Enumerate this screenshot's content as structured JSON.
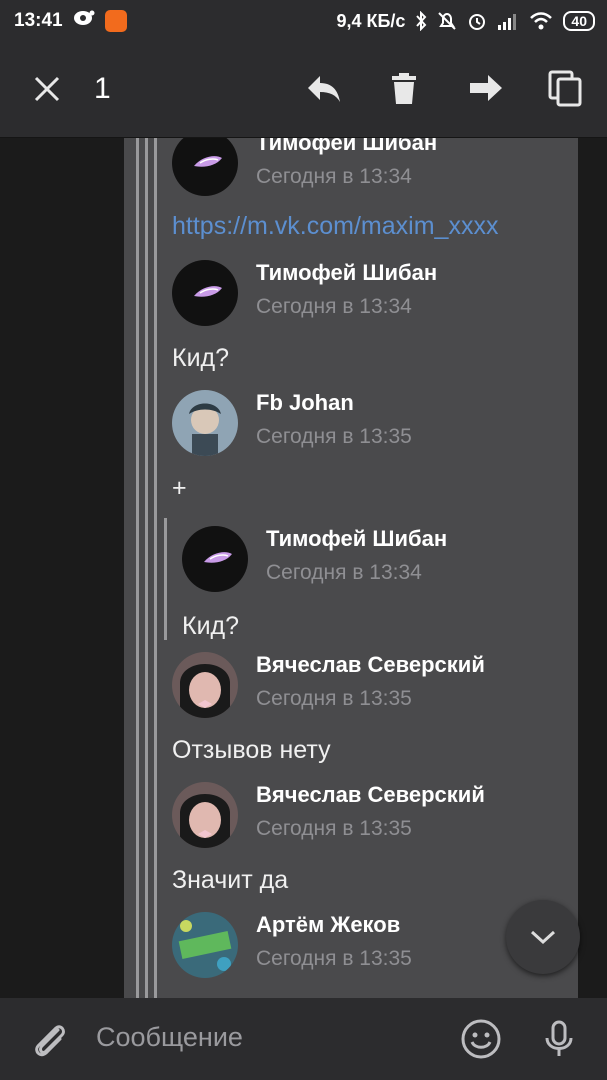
{
  "status_bar": {
    "time": "13:41",
    "network_speed": "9,4 КБ/с",
    "battery": "40"
  },
  "action_bar": {
    "selected_count": "1"
  },
  "messages": [
    {
      "author": "Тимофей Шибан",
      "time": "Сегодня в 13:34",
      "link": "https://m.vk.com/maxim_xxxx"
    },
    {
      "author": "Тимофей Шибан",
      "time": "Сегодня в 13:34",
      "text": "Кид?"
    },
    {
      "author": "Fb Johan",
      "time": "Сегодня в 13:35",
      "text": "+"
    },
    {
      "author": "Тимофей Шибан",
      "time": "Сегодня в 13:34",
      "text": "Кид?"
    },
    {
      "author": "Вячеслав Северский",
      "time": "Сегодня в 13:35",
      "text": "Отзывов нету"
    },
    {
      "author": "Вячеслав Северский",
      "time": "Сегодня в 13:35",
      "text": "Значит да"
    },
    {
      "author": "Артём Жеков",
      "time": "Сегодня в 13:35"
    }
  ],
  "composer": {
    "placeholder": "Сообщение"
  },
  "icons": {
    "close": "close-icon",
    "reply": "reply-icon",
    "delete": "trash-icon",
    "forward": "forward-icon",
    "copy": "copy-icon",
    "scroll_down": "chevron-down-icon",
    "attach": "paperclip-icon",
    "emoji": "emoji-icon",
    "mic": "microphone-icon"
  },
  "colors": {
    "bar_bg": "#2c2c2e",
    "message_bg": "#4a4a4c",
    "link": "#5c8fd0",
    "secondary_text": "#8f8f93"
  }
}
